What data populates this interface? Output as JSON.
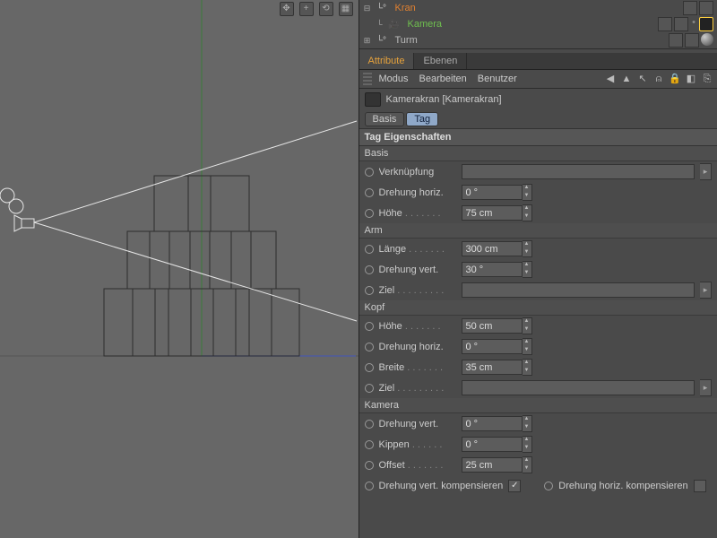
{
  "objects": {
    "kran": "Kran",
    "kamera": "Kamera",
    "turm": "Turm"
  },
  "tabs": {
    "attribute": "Attribute",
    "ebenen": "Ebenen"
  },
  "menu": {
    "modus": "Modus",
    "bearbeiten": "Bearbeiten",
    "benutzer": "Benutzer"
  },
  "object_title": "Kamerakran [Kamerakran]",
  "pills": {
    "basis": "Basis",
    "tag": "Tag"
  },
  "sections": {
    "tagprops": "Tag Eigenschaften"
  },
  "groups": {
    "basis": "Basis",
    "arm": "Arm",
    "kopf": "Kopf",
    "kamera": "Kamera"
  },
  "basis": {
    "verknuepfung": {
      "label": "Verknüpfung"
    },
    "drehung_horiz": {
      "label": "Drehung horiz.",
      "value": "0 °"
    },
    "hoehe": {
      "label": "Höhe",
      "value": "75 cm"
    }
  },
  "arm": {
    "laenge": {
      "label": "Länge",
      "value": "300 cm"
    },
    "drehung_vert": {
      "label": "Drehung vert.",
      "value": "30 °"
    },
    "ziel": {
      "label": "Ziel"
    }
  },
  "kopf": {
    "hoehe": {
      "label": "Höhe",
      "value": "50 cm"
    },
    "drehung_horiz": {
      "label": "Drehung horiz.",
      "value": "0 °"
    },
    "breite": {
      "label": "Breite",
      "value": "35 cm"
    },
    "ziel": {
      "label": "Ziel"
    }
  },
  "kamera": {
    "drehung_vert": {
      "label": "Drehung vert.",
      "value": "0 °"
    },
    "kippen": {
      "label": "Kippen",
      "value": "0 °"
    },
    "offset": {
      "label": "Offset",
      "value": "25 cm"
    },
    "komp_vert": {
      "label": "Drehung vert. kompensieren",
      "checked": true
    },
    "komp_horiz": {
      "label": "Drehung horiz. kompensieren",
      "checked": false
    }
  }
}
